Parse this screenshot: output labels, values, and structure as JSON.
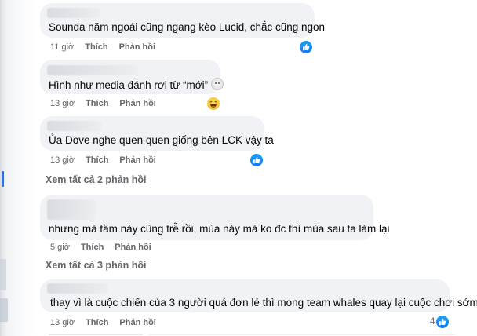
{
  "comments": [
    {
      "text": "Sounda năm ngoái cũng ngang kèo Lucid, chắc cũng ngon",
      "time": "11 giờ",
      "reaction": "like",
      "reaction_count": ""
    },
    {
      "text": "Hình như media đánh rơi từ “mới”",
      "time": "13 giờ",
      "reaction": "haha",
      "reaction_count": ""
    },
    {
      "text": "Ủa Dove nghe quen quen giống bên LCK vậy ta",
      "time": "13 giờ",
      "reaction": "like",
      "reaction_count": ""
    },
    {
      "text": "nhưng mà tầm này cũng trễ rồi, mùa này mà ko đc thì mùa sau ta làm lại",
      "time": "5 giờ",
      "reaction": "",
      "reaction_count": ""
    },
    {
      "text": "thay vì là cuộc chiến của 3 người quá đơn lẻ thì mong team whales quay lại cuộc chơi sớm",
      "time": "13 giờ",
      "reaction": "like",
      "reaction_count": "4"
    }
  ],
  "actions": {
    "like": "Thích",
    "reply": "Phản hồi"
  },
  "see_more_1": "Xem tất cả 2 phản hồi",
  "see_more_2": "Xem tất cả 3 phản hồi",
  "colors": {
    "bubble": "#f0f2f5",
    "meta": "#65676b",
    "like": "#1877f2"
  }
}
